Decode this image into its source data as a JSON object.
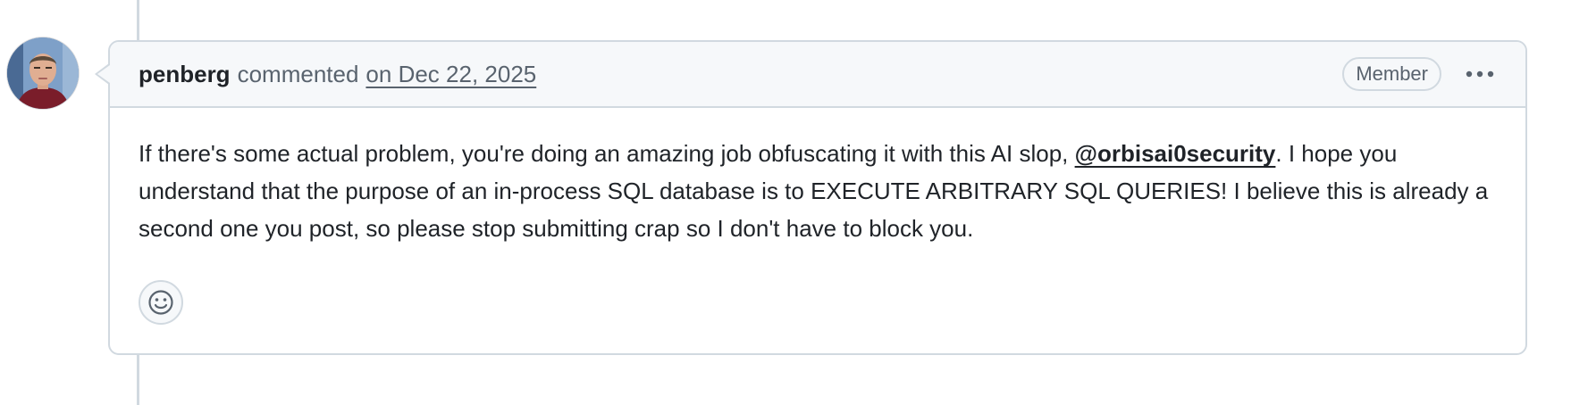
{
  "comment": {
    "author": "penberg",
    "action": "commented",
    "date": "on Dec 22, 2025",
    "badge": "Member",
    "body": {
      "part1": "If there's some actual problem, you're doing an amazing job obfuscating it with this AI slop, ",
      "mention": "@orbisai0security",
      "part2": ". I hope you understand that the purpose of an in-process SQL database is to EXECUTE ARBITRARY SQL QUERIES! I believe this is already a second one you post, so please stop submitting crap so I don't have to block you."
    }
  },
  "icons": {
    "avatar": "user-avatar",
    "menu": "kebab-horizontal-icon",
    "reaction": "smiley-icon"
  },
  "colors": {
    "border": "#d1d9e0",
    "header_bg": "#f6f8fa",
    "muted_text": "#59636e",
    "text": "#1f2328"
  }
}
